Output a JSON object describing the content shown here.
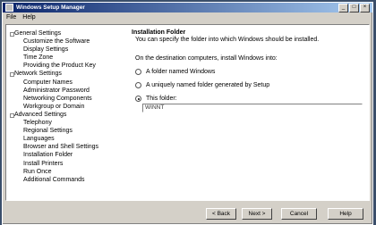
{
  "window": {
    "title": "Windows Setup Manager"
  },
  "menu": [
    "File",
    "Help"
  ],
  "tree": [
    {
      "label": "General Settings",
      "level": 0
    },
    {
      "label": "Customize the Software",
      "level": 1
    },
    {
      "label": "Display Settings",
      "level": 1
    },
    {
      "label": "Time Zone",
      "level": 1
    },
    {
      "label": "Providing the Product Key",
      "level": 1
    },
    {
      "label": "Network Settings",
      "level": 0
    },
    {
      "label": "Computer Names",
      "level": 1
    },
    {
      "label": "Administrator Password",
      "level": 1
    },
    {
      "label": "Networking Components",
      "level": 1
    },
    {
      "label": "Workgroup or Domain",
      "level": 1
    },
    {
      "label": "Advanced Settings",
      "level": 0
    },
    {
      "label": "Telephony",
      "level": 1
    },
    {
      "label": "Regional Settings",
      "level": 1
    },
    {
      "label": "Languages",
      "level": 1
    },
    {
      "label": "Browser and Shell Settings",
      "level": 1
    },
    {
      "label": "Installation Folder",
      "level": 1,
      "selected": true
    },
    {
      "label": "Install Printers",
      "level": 1
    },
    {
      "label": "Run Once",
      "level": 1
    },
    {
      "label": "Additional Commands",
      "level": 1
    }
  ],
  "content": {
    "heading": "Installation Folder",
    "description": "You can specify the folder into which Windows should be installed.",
    "question": "On the destination computers, install Windows into:",
    "options": [
      {
        "label": "A folder named Windows",
        "selected": false
      },
      {
        "label": "A uniquely named folder generated by Setup",
        "selected": false
      },
      {
        "label": "This folder:",
        "selected": true
      }
    ],
    "folder_value": "WINNT"
  },
  "buttons": {
    "back": "< Back",
    "next": "Next >",
    "cancel": "Cancel",
    "help": "Help"
  }
}
